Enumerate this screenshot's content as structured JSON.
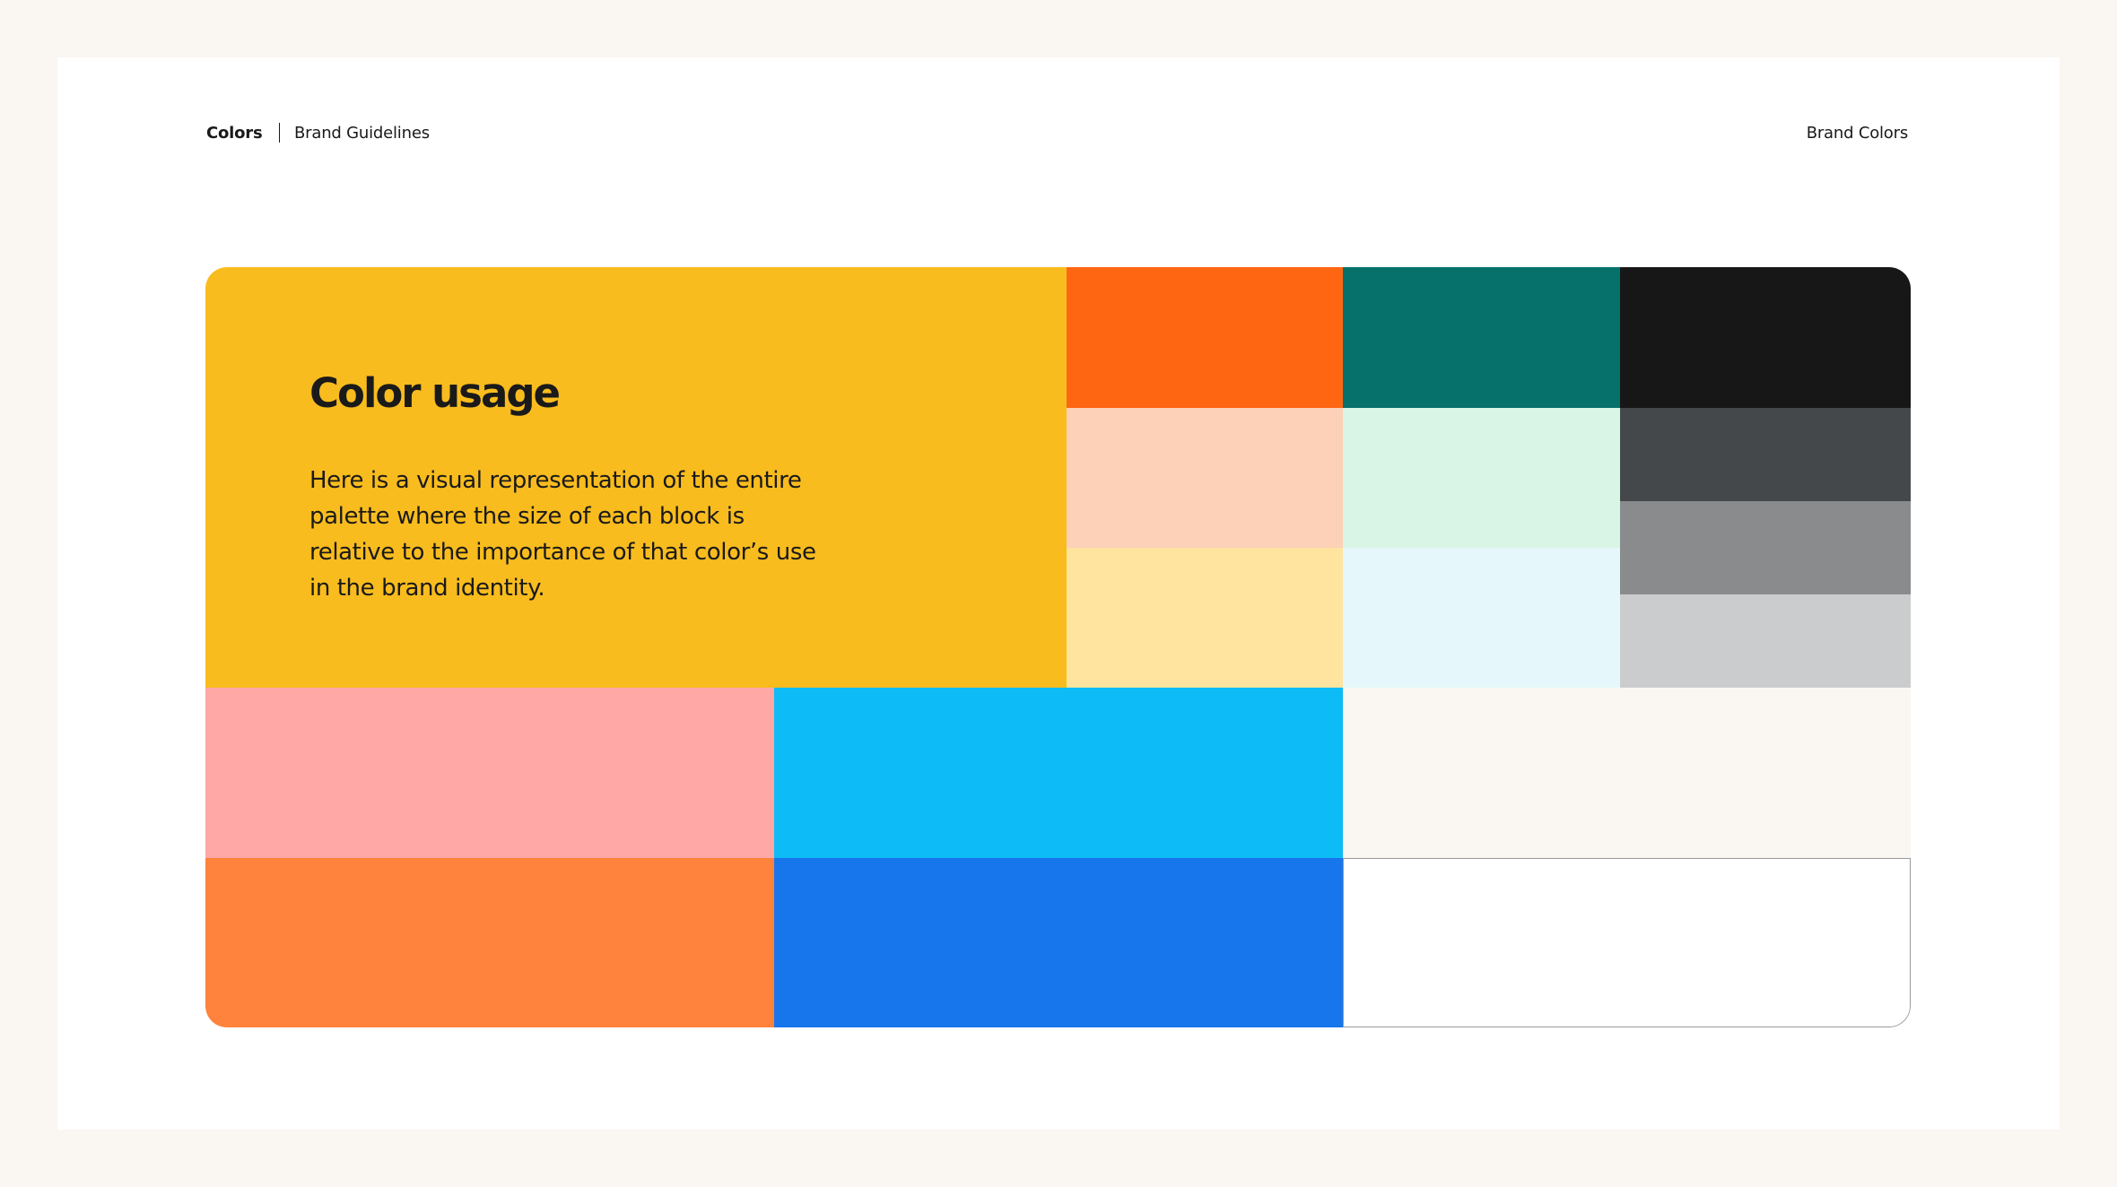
{
  "header": {
    "section": "Colors",
    "document": "Brand Guidelines",
    "page_label": "Brand Colors"
  },
  "intro": {
    "title": "Color usage",
    "body": "Here is a visual representation of the entire palette where the size of each block is relative to the importance of that color’s use in the brand identity."
  },
  "palette": {
    "swatches": [
      {
        "name": "yellow",
        "hex": "#F9BC1E"
      },
      {
        "name": "orange",
        "hex": "#FF6612"
      },
      {
        "name": "teal",
        "hex": "#06716A"
      },
      {
        "name": "black",
        "hex": "#171717"
      },
      {
        "name": "peach",
        "hex": "#FDD0B8"
      },
      {
        "name": "mint",
        "hex": "#D9F5E6"
      },
      {
        "name": "dark-gray",
        "hex": "#45484A"
      },
      {
        "name": "light-yellow",
        "hex": "#FEE49F"
      },
      {
        "name": "light-cyan",
        "hex": "#E5F7FA"
      },
      {
        "name": "mid-gray",
        "hex": "#898B8D"
      },
      {
        "name": "light-gray",
        "hex": "#CBCCCD"
      },
      {
        "name": "pink",
        "hex": "#FFA8A6"
      },
      {
        "name": "sky-blue",
        "hex": "#0DBCF6"
      },
      {
        "name": "cream",
        "hex": "#FAF6F1"
      },
      {
        "name": "light-orange",
        "hex": "#FF833D"
      },
      {
        "name": "blue",
        "hex": "#1876EC"
      },
      {
        "name": "white",
        "hex": "#FFFFFF"
      }
    ]
  }
}
